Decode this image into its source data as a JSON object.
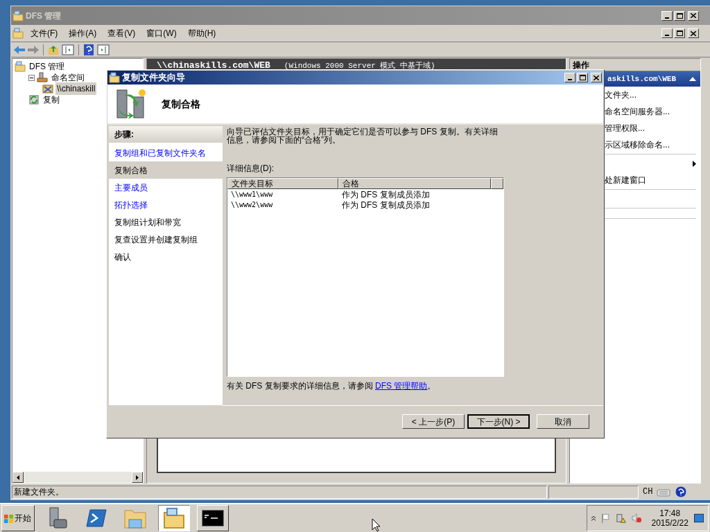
{
  "main_window": {
    "title": "DFS 管理",
    "menu": [
      "文件(F)",
      "操作(A)",
      "查看(V)",
      "窗口(W)",
      "帮助(H)"
    ],
    "tree": [
      {
        "label": "DFS 管理",
        "kind": "dfs",
        "selected": false,
        "children": [
          {
            "label": "命名空间",
            "kind": "namespace",
            "selected": false,
            "expanded": true,
            "children": [
              {
                "label": "\\\\chinaskill",
                "kind": "share",
                "selected": true
              }
            ]
          },
          {
            "label": "复制",
            "kind": "replication",
            "selected": false
          }
        ]
      }
    ],
    "center_header": {
      "path": "\\\\chinaskills.com\\WEB",
      "mode": "(Windows 2000 Server 模式 中基于域)"
    },
    "actions": {
      "title": "操作",
      "section": "askills.com\\WEB",
      "items": [
        {
          "kind": "action",
          "label": "文件夹..."
        },
        {
          "kind": "action",
          "label": "命名空间服务器..."
        },
        {
          "kind": "action",
          "label": "管理权限..."
        },
        {
          "kind": "action",
          "label": "示区域移除命名..."
        },
        {
          "kind": "separator"
        },
        {
          "kind": "submenu"
        },
        {
          "kind": "action",
          "label": "处新建窗口"
        },
        {
          "kind": "separator"
        },
        {
          "kind": "blank"
        },
        {
          "kind": "blank"
        },
        {
          "kind": "separator"
        },
        {
          "kind": "blank"
        },
        {
          "kind": "separator"
        },
        {
          "kind": "blank"
        }
      ]
    },
    "status": "新建文件夹。"
  },
  "language_bar": {
    "language": "CH"
  },
  "dialog": {
    "title": "复制文件夹向导",
    "heading": "复制合格",
    "steps_title": "步骤:",
    "steps": [
      {
        "label": "复制组和已复制文件夹名",
        "kind": "link",
        "selected": false
      },
      {
        "label": "复制合格",
        "kind": "text",
        "selected": true
      },
      {
        "label": "主要成员",
        "kind": "link",
        "selected": false
      },
      {
        "label": "拓扑选择",
        "kind": "link",
        "selected": false
      },
      {
        "label": "复制组计划和带宽",
        "kind": "text",
        "selected": false
      },
      {
        "label": "复查设置并创建复制组",
        "kind": "text",
        "selected": false
      },
      {
        "label": "确认",
        "kind": "text",
        "selected": false
      }
    ],
    "description": "向导已评估文件夹目标，用于确定它们是否可以参与 DFS 复制。有关详细信息，请参阅下面的“合格”列。",
    "details_label": "详细信息(D):",
    "columns": [
      "文件夹目标",
      "合格"
    ],
    "rows": [
      [
        "\\\\www1\\www",
        "作为 DFS 复制成员添加"
      ],
      [
        "\\\\www2\\www",
        "作为 DFS 复制成员添加"
      ]
    ],
    "help": {
      "before": "有关 DFS 复制要求的详细信息，请参阅 ",
      "link": "DFS 管理帮助",
      "after": "。"
    },
    "buttons": [
      {
        "label": "< 上一步(P)",
        "default": false
      },
      {
        "label": "下一步(N) >",
        "default": true
      },
      {
        "label": "取消",
        "default": false
      }
    ]
  },
  "taskbar": {
    "start": "开始",
    "apps": [
      {
        "kind": "server",
        "selected": false
      },
      {
        "kind": "powershell",
        "selected": false
      },
      {
        "kind": "explorer",
        "selected": false
      },
      {
        "kind": "dfs",
        "selected": true
      },
      {
        "kind": "terminal",
        "selected": false
      }
    ],
    "time": "17:48",
    "date": "2015/2/22"
  }
}
